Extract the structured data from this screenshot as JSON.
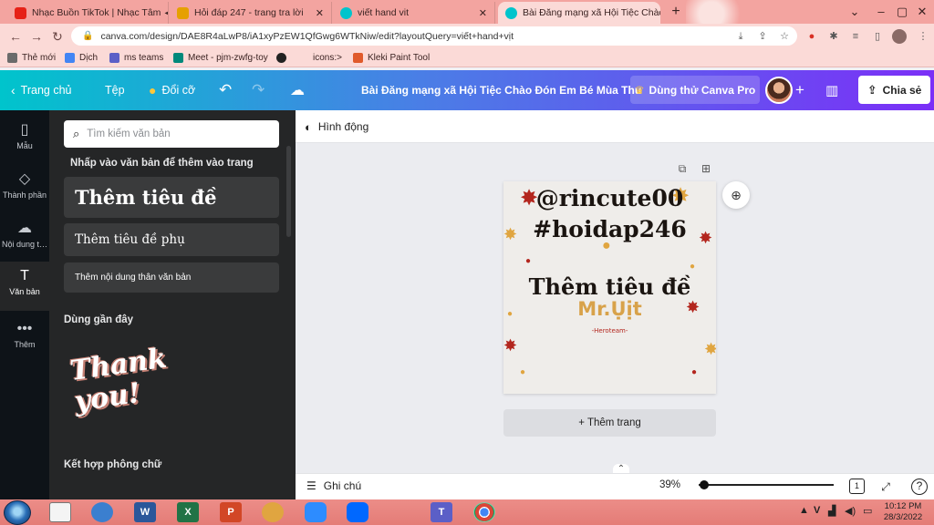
{
  "browser": {
    "tabs": [
      {
        "title": "Nhạc Buồn TikTok | Nhạc Tâm",
        "icon_color": "#e62117",
        "close": "✕"
      },
      {
        "title": "Hỏi đáp 247 - trang tra lời",
        "icon_color": "#e6a000",
        "close": "✕"
      },
      {
        "title": "viết hand vit",
        "icon_color": "#00c4cc",
        "close": "✕"
      },
      {
        "title": "Bài Đăng mạng xã Hội Tiệc Chào",
        "icon_color": "#00c4cc",
        "close": "✕"
      }
    ],
    "new_tab": "+",
    "url": "canva.com/design/DAE8R4aLwP8/iA1xyPzEW1QfGwg6WTkNiw/edit?layoutQuery=viết+hand+vịt",
    "bookmarks": [
      {
        "label": "Thẻ mới",
        "color": "#6b6b6b"
      },
      {
        "label": "Dịch",
        "color": "#4285f4"
      },
      {
        "label": "ms teams",
        "color": "#5b5fc7"
      },
      {
        "label": "Meet - pjm-zwfg-toy",
        "color": "#00897b"
      },
      {
        "label": "icons:>",
        "color": "#222222"
      },
      {
        "label": "Kleki Paint Tool",
        "color": "#e05a2b"
      }
    ]
  },
  "canva": {
    "header": {
      "home": "Trang chủ",
      "file": "Tệp",
      "resize": "Đổi cỡ",
      "title": "Bài Đăng mạng xã Hội Tiệc Chào Đón Em Bé Mùa Thu",
      "pro": "Dùng thử Canva Pro",
      "add": "+",
      "share": "Chia sẻ"
    },
    "rail": [
      {
        "label": "Mẫu",
        "icon": "▯"
      },
      {
        "label": "Thành phần",
        "icon": "◇"
      },
      {
        "label": "Nội dung t…",
        "icon": "☁"
      },
      {
        "label": "Văn bản",
        "icon": "T"
      },
      {
        "label": "Thêm",
        "icon": "•••"
      }
    ],
    "panel": {
      "search_placeholder": "Tìm kiếm văn bản",
      "hint": "Nhấp vào văn bản để thêm vào trang",
      "heading": "Thêm tiêu đề",
      "subheading": "Thêm tiêu đề phụ",
      "body": "Thêm nội dung thân văn bản",
      "recent": "Dùng gần đây",
      "recent_item": "Thank you!",
      "combos": "Kết hợp phông chữ"
    },
    "editor": {
      "animate": "Hình động",
      "design": {
        "line1": "@rincute00",
        "line2": "#hoidap246",
        "heading": "Thêm tiêu đề",
        "brand": "Mr.Ụịt",
        "small": "-Heroteam-",
        "accent": "#d8a24a",
        "leaf_red": "#b3261e",
        "leaf_gold": "#e0a540"
      },
      "add_page": "+ Thêm trang"
    },
    "footer": {
      "notes": "Ghi chú",
      "zoom": "39%",
      "zoom_fraction": 0.01,
      "page": "1"
    }
  },
  "taskbar": {
    "apps": [
      {
        "label": "W",
        "color": "#2b579a"
      },
      {
        "label": "X",
        "color": "#217346"
      },
      {
        "label": "P",
        "color": "#d24726"
      },
      {
        "label": "T",
        "color": "#5b5fc7"
      }
    ],
    "tray": "V",
    "time": "10:12 PM",
    "date": "28/3/2022"
  }
}
